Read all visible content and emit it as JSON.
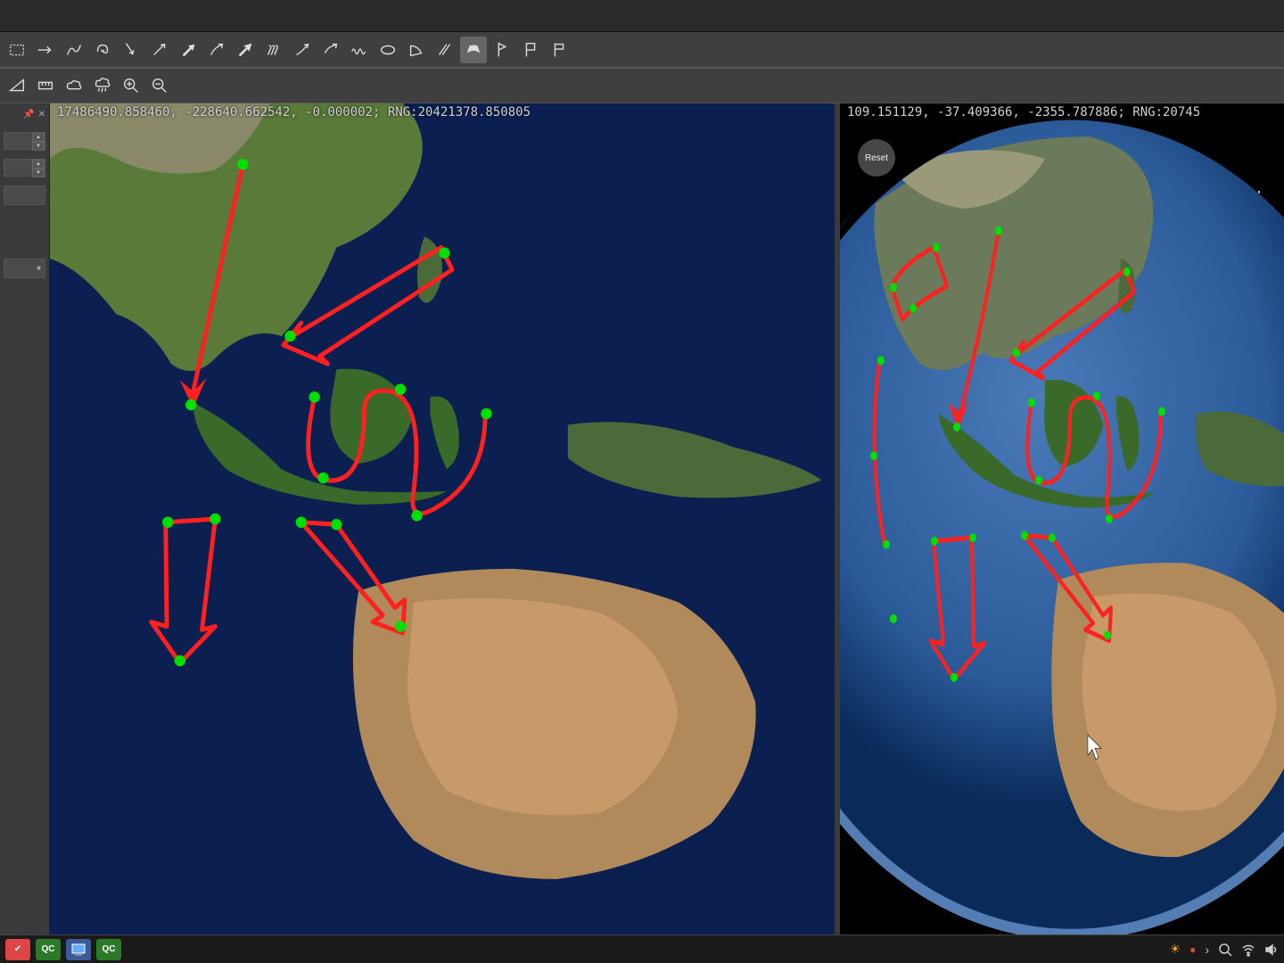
{
  "toolbar1": {
    "tools": [
      "selection-rect",
      "arrow-straight",
      "curve-s",
      "loop",
      "arrow-down",
      "arrow-diag",
      "arrow-filled",
      "arrow-curved-1",
      "arrow-filled-diag",
      "multi-arrow",
      "arrow-curved-2",
      "arrow-curved-3",
      "wave",
      "ellipse",
      "sector",
      "lines",
      "fov-cone",
      "flag-triangle",
      "flag-rect",
      "flag-square"
    ],
    "active": "fov-cone"
  },
  "toolbar2": {
    "tools": [
      "triangle-tool",
      "measure-tool",
      "cloud-tool",
      "rain-tool",
      "zoom-in",
      "zoom-out"
    ]
  },
  "panel": {
    "pin": "📌",
    "close": "✕"
  },
  "view_left": {
    "coords": "17486490.858460, -228640.662542, -0.000002; RNG:20421378.850805",
    "divider": "|"
  },
  "view_right": {
    "coords": "109.151129, -37.409366, -2355.787886; RNG:20745",
    "reset_label": "Reset"
  },
  "taskbar": {
    "qc": "QC"
  },
  "tray": {
    "sun": "☀",
    "rec": "●"
  }
}
